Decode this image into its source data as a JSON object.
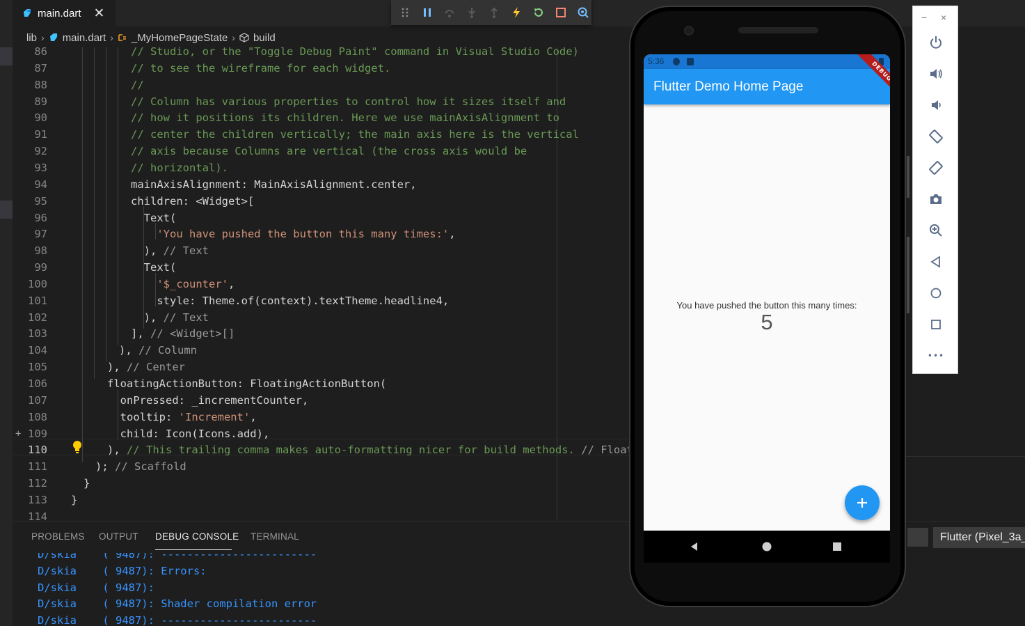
{
  "tab": {
    "filename": "main.dart",
    "close_glyph": "✕"
  },
  "debug_toolbar": {
    "buttons": [
      "drag-handle-icon",
      "pause-icon",
      "step-over-icon",
      "step-into-icon",
      "step-out-icon",
      "hot-reload-icon",
      "restart-icon",
      "stop-icon",
      "inspect-icon"
    ]
  },
  "breadcrumb": {
    "items": [
      "lib",
      "main.dart",
      "_MyHomePageState",
      "build"
    ]
  },
  "editor": {
    "lines": [
      {
        "n": "86",
        "segs": [
          [
            "c-com",
            "// Studio, or the \"Toggle Debug Paint\" command in Visual Studio Code)"
          ]
        ]
      },
      {
        "n": "87",
        "segs": [
          [
            "c-com",
            "// to see the wireframe for each widget."
          ]
        ]
      },
      {
        "n": "88",
        "segs": [
          [
            "c-com",
            "//"
          ]
        ]
      },
      {
        "n": "89",
        "segs": [
          [
            "c-com",
            "// Column has various properties to control how it sizes itself and"
          ]
        ]
      },
      {
        "n": "90",
        "segs": [
          [
            "c-com",
            "// how it positions its children. Here we use mainAxisAlignment to"
          ]
        ]
      },
      {
        "n": "91",
        "segs": [
          [
            "c-com",
            "// center the children vertically; the main axis here is the vertical"
          ]
        ]
      },
      {
        "n": "92",
        "segs": [
          [
            "c-com",
            "// axis because Columns are vertical (the cross axis would be"
          ]
        ]
      },
      {
        "n": "93",
        "segs": [
          [
            "c-com",
            "// horizontal)."
          ]
        ]
      },
      {
        "n": "94",
        "segs": [
          [
            "c-id",
            "mainAxisAlignment: MainAxisAlignment.center,"
          ]
        ]
      },
      {
        "n": "95",
        "segs": [
          [
            "c-id",
            "children: <Widget>["
          ]
        ]
      },
      {
        "n": "96",
        "segs": [
          [
            "c-id",
            "  Text("
          ]
        ]
      },
      {
        "n": "97",
        "segs": [
          [
            "c-id",
            "    "
          ],
          [
            "c-str",
            "'You have pushed the button this many times:'"
          ],
          [
            "c-id",
            ","
          ]
        ]
      },
      {
        "n": "98",
        "segs": [
          [
            "c-id",
            "  ), "
          ],
          [
            "c-fold",
            "// Text"
          ]
        ]
      },
      {
        "n": "99",
        "segs": [
          [
            "c-id",
            "  Text("
          ]
        ]
      },
      {
        "n": "100",
        "segs": [
          [
            "c-id",
            "    "
          ],
          [
            "c-str",
            "'$_counter'"
          ],
          [
            "c-id",
            ","
          ]
        ]
      },
      {
        "n": "101",
        "segs": [
          [
            "c-id",
            "    style: Theme.of(context).textTheme.headline4,"
          ]
        ]
      },
      {
        "n": "102",
        "segs": [
          [
            "c-id",
            "  ), "
          ],
          [
            "c-fold",
            "// Text"
          ]
        ]
      },
      {
        "n": "103",
        "segs": [
          [
            "c-id",
            "], "
          ],
          [
            "c-fold",
            "// <Widget>[]"
          ]
        ]
      },
      {
        "n": "104",
        "segs": [
          [
            "c-id",
            "), "
          ],
          [
            "c-fold",
            "// Column"
          ]
        ]
      },
      {
        "n": "105",
        "segs": [
          [
            "c-id",
            "), "
          ],
          [
            "c-fold",
            "// Center"
          ]
        ]
      },
      {
        "n": "106",
        "segs": [
          [
            "c-id",
            "floatingActionButton: FloatingActionButton("
          ]
        ]
      },
      {
        "n": "107",
        "segs": [
          [
            "c-id",
            "  onPressed: _incrementCounter,"
          ]
        ]
      },
      {
        "n": "108",
        "segs": [
          [
            "c-id",
            "  tooltip: "
          ],
          [
            "c-str",
            "'Increment'"
          ],
          [
            "c-id",
            ","
          ]
        ]
      },
      {
        "n": "109",
        "segs": [
          [
            "c-id",
            "  child: Icon(Icons.add),"
          ]
        ]
      },
      {
        "n": "110",
        "segs": [
          [
            "c-id",
            "), "
          ],
          [
            "c-com",
            "// This trailing comma makes auto-formatting nicer for build methods."
          ],
          [
            "c-fold",
            " // FloatingAc"
          ]
        ]
      },
      {
        "n": "111",
        "segs": [
          [
            "c-id",
            "); "
          ],
          [
            "c-fold",
            "// Scaffold"
          ]
        ]
      },
      {
        "n": "112",
        "segs": [
          [
            "c-id",
            "}"
          ]
        ]
      },
      {
        "n": "113",
        "segs": [
          [
            "c-id",
            "}"
          ]
        ]
      },
      {
        "n": "114",
        "segs": []
      }
    ],
    "active_line": "110",
    "gutter_added_line": "109",
    "gutter_plus": "+"
  },
  "panel": {
    "tabs": [
      "PROBLEMS",
      "OUTPUT",
      "DEBUG CONSOLE",
      "TERMINAL"
    ],
    "active_tab": "DEBUG CONSOLE",
    "console_lines": [
      "D/skia    ( 9487): ------------------------",
      "D/skia    ( 9487): Errors:",
      "D/skia    ( 9487):",
      "D/skia    ( 9487): Shader compilation error",
      "D/skia    ( 9487): ------------------------"
    ],
    "device_selector": "Flutter (Pixel_3a_"
  },
  "emulator": {
    "status_time": "5:36",
    "app_title": "Flutter Demo Home Page",
    "debug_banner": "DEBUG",
    "counter_caption": "You have pushed the button this many times:",
    "counter_value": "5",
    "fab_icon": "add-icon",
    "nav_icons": [
      "back-icon",
      "home-icon",
      "recents-icon"
    ],
    "colors": {
      "appbar": "#2196f3",
      "statusbar": "#1976d2",
      "fab": "#2196f3",
      "banner": "#b71c1c"
    }
  },
  "emulator_toolbar": {
    "window_controls": [
      "−",
      "×"
    ],
    "buttons": [
      "power-icon",
      "volume-up-icon",
      "volume-down-icon",
      "rotate-left-icon",
      "rotate-right-icon",
      "camera-icon",
      "zoom-icon",
      "back-icon",
      "home-icon",
      "overview-icon",
      "more-icon"
    ],
    "more_glyph": "•••"
  }
}
